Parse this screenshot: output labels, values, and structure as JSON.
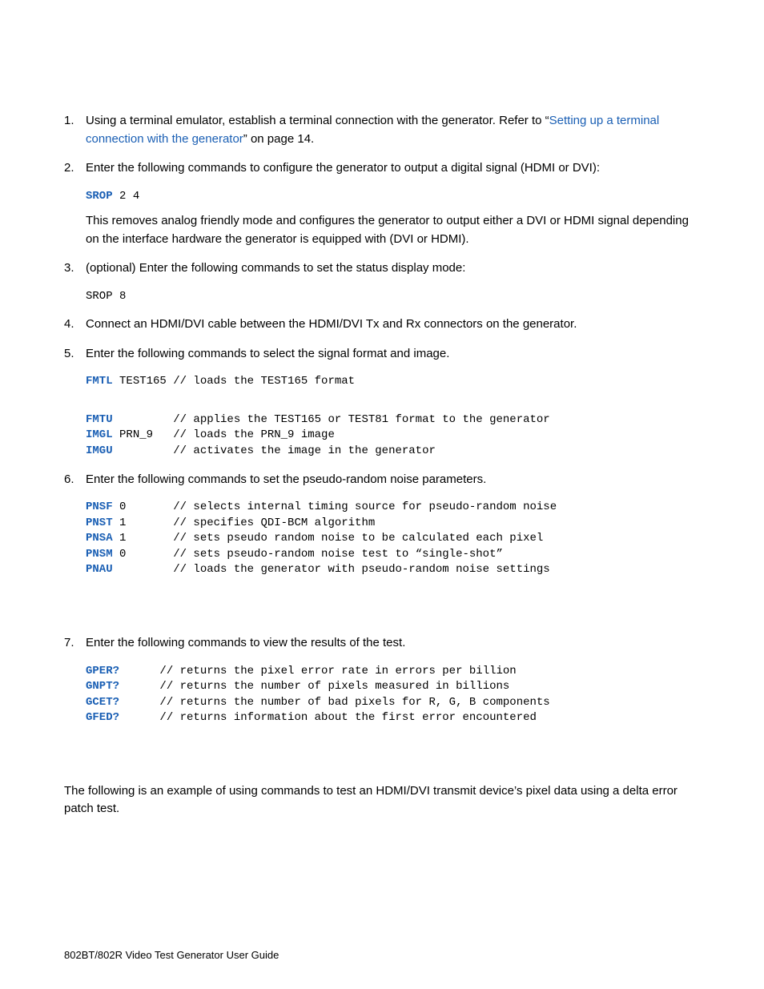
{
  "steps": {
    "s1": {
      "pre": "Using a terminal emulator, establish a terminal connection with the generator. Refer to “",
      "link": "Setting up a terminal connection with the generator",
      "post": "” on page 14."
    },
    "s2": {
      "intro": "Enter the following commands to configure the generator to output a digital signal (HDMI or DVI):",
      "cmd_kw": "SROP",
      "cmd_rest": " 2 4",
      "note": "This removes analog friendly mode and configures the generator to output either a DVI or HDMI signal depending on the interface hardware the generator is equipped with (DVI or HDMI)."
    },
    "s3": {
      "intro": "(optional) Enter the following commands to set the status display mode:",
      "cmd": "SROP 8"
    },
    "s4": {
      "text": "Connect an HDMI/DVI cable between the HDMI/DVI Tx and Rx connectors on the generator."
    },
    "s5": {
      "intro": "Enter the following commands to select the signal format and image.",
      "l1_kw": "FMTL",
      "l1_rest": " TEST165 // loads the TEST165 format",
      "l2_kw": "FMTU",
      "l2_rest": "         // applies the TEST165 or TEST81 format to the generator",
      "l3_kw": "IMGL",
      "l3_rest": " PRN_9   // loads the PRN_9 image",
      "l4_kw": "IMGU",
      "l4_rest": "         // activates the image in the generator"
    },
    "s6": {
      "intro": "Enter the following commands to set the pseudo-random noise parameters.",
      "l1_kw": "PNSF",
      "l1_rest": " 0       // selects internal timing source for pseudo-random noise",
      "l2_kw": "PNST",
      "l2_rest": " 1       // specifies QDI-BCM algorithm",
      "l3_kw": "PNSA",
      "l3_rest": " 1       // sets pseudo random noise to be calculated each pixel",
      "l4_kw": "PNSM",
      "l4_rest": " 0       // sets pseudo-random noise test to “single-shot”",
      "l5_kw": "PNAU",
      "l5_rest": "         // loads the generator with pseudo-random noise settings"
    },
    "s7": {
      "intro": "Enter the following commands to view the results of the test.",
      "l1_kw": "GPER?",
      "l1_rest": "      // returns the pixel error rate in errors per billion",
      "l2_kw": "GNPT?",
      "l2_rest": "      // returns the number of pixels measured in billions",
      "l3_kw": "GCET?",
      "l3_rest": "      // returns the number of bad pixels for R, G, B components",
      "l4_kw": "GFED?",
      "l4_rest": "      // returns information about the first error encountered"
    }
  },
  "closing": "The following is an example of using commands to test an HDMI/DVI transmit device’s pixel data using a delta error patch test.",
  "footer": "802BT/802R Video Test Generator User Guide"
}
